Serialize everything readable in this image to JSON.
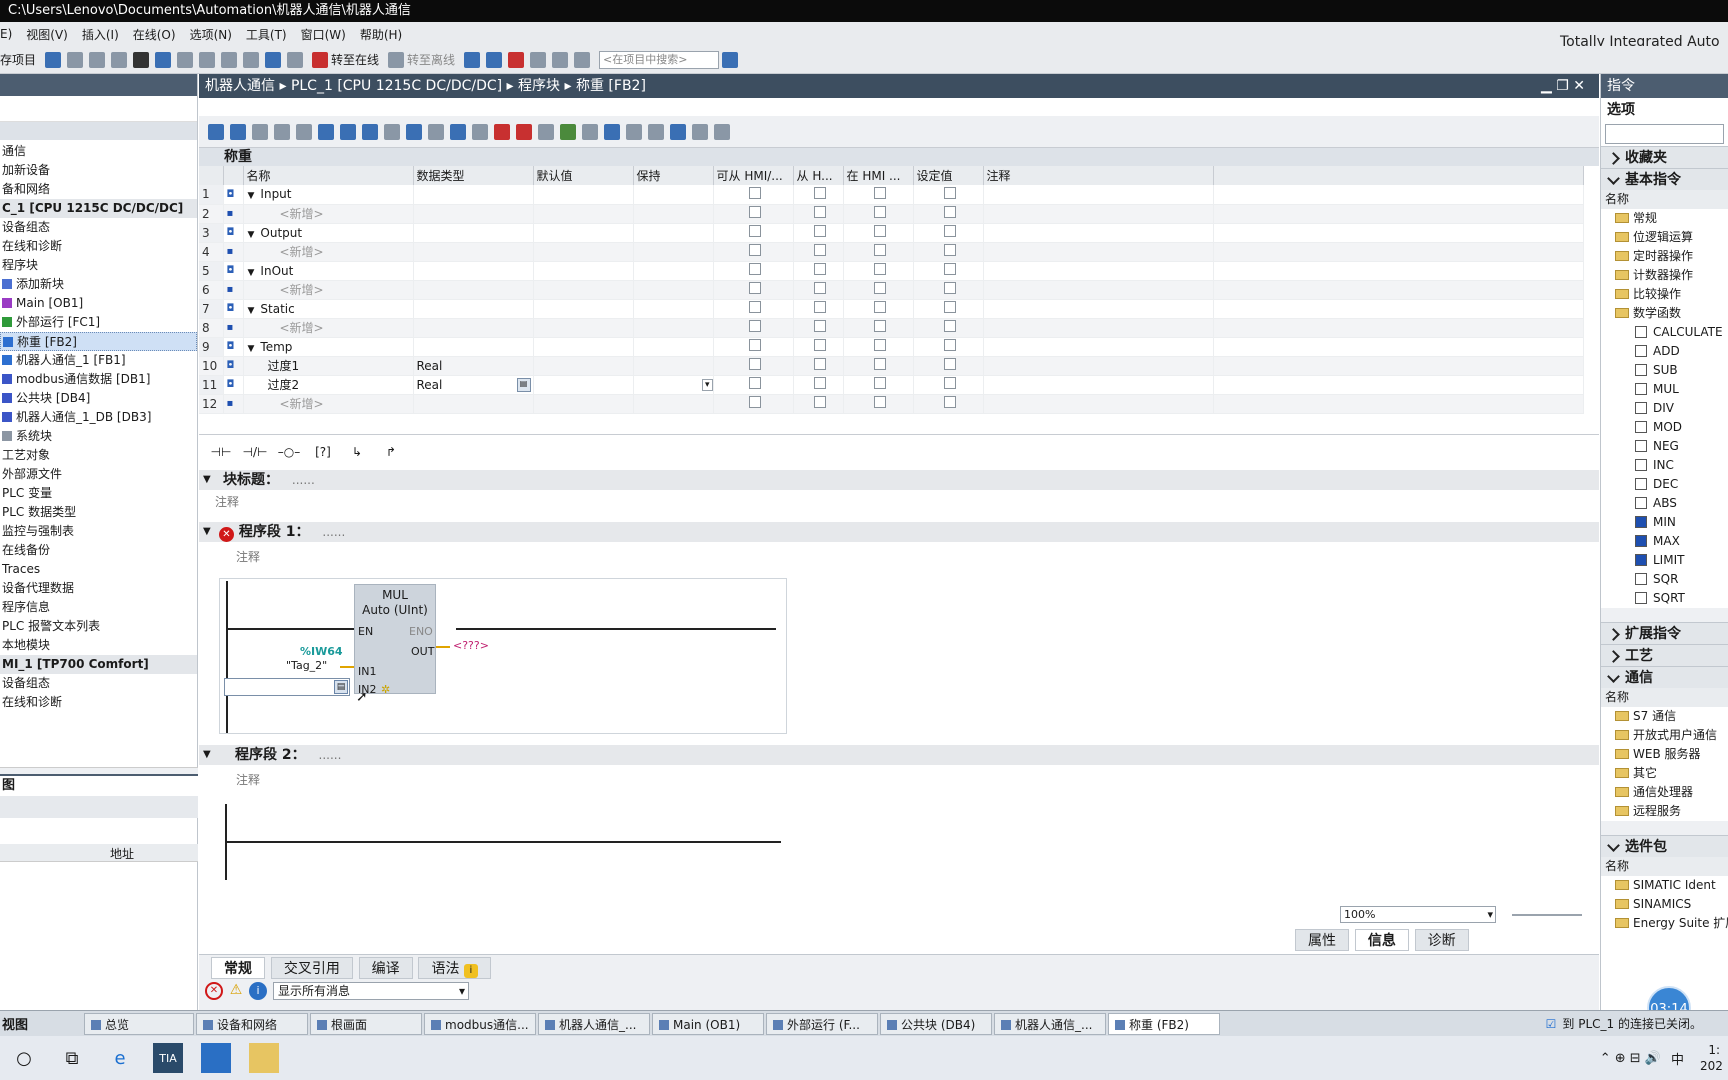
{
  "window": {
    "title": "C:\\Users\\Lenovo\\Documents\\Automation\\机器人通信\\机器人通信"
  },
  "menu": [
    "E)",
    "视图(V)",
    "插入(I)",
    "在线(O)",
    "选项(N)",
    "工具(T)",
    "窗口(W)",
    "帮助(H)"
  ],
  "brand": "Totally Integrated Auto",
  "toolbar": {
    "save_project": "存项目",
    "go_online": "转至在线",
    "go_offline": "转至离线",
    "search_placeholder": "<在项目中搜索>"
  },
  "left_tree": [
    "通信",
    "加新设备",
    "备和网络",
    "C_1 [CPU 1215C DC/DC/DC]",
    "设备组态",
    "在线和诊断",
    "程序块",
    "添加新块",
    "Main [OB1]",
    "外部运行 [FC1]",
    "称重 [FB2]",
    "机器人通信_1 [FB1]",
    "modbus通信数据 [DB1]",
    "公共块 [DB4]",
    "机器人通信_1_DB [DB3]",
    "系统块",
    "工艺对象",
    "外部源文件",
    "PLC 变量",
    "PLC 数据类型",
    "监控与强制表",
    "在线备份",
    "Traces",
    "设备代理数据",
    "程序信息",
    "PLC 报警文本列表",
    "本地模块",
    "MI_1 [TP700 Comfort]",
    "设备组态",
    "在线和诊断"
  ],
  "left_bottom": {
    "title": "图",
    "col": "地址"
  },
  "editor": {
    "breadcrumb": [
      "机器人通信",
      "PLC_1 [CPU 1215C DC/DC/DC]",
      "程序块",
      "称重 [FB2]"
    ],
    "block_title": "称重",
    "columns": [
      "名称",
      "数据类型",
      "默认值",
      "保持",
      "可从 HMI/...",
      "从 H...",
      "在 HMI ...",
      "设定值",
      "注释"
    ],
    "rows": [
      {
        "n": "1",
        "name": "Input",
        "type": ""
      },
      {
        "n": "2",
        "name": "<新增>",
        "type": ""
      },
      {
        "n": "3",
        "name": "Output",
        "type": ""
      },
      {
        "n": "4",
        "name": "<新增>",
        "type": ""
      },
      {
        "n": "5",
        "name": "InOut",
        "type": ""
      },
      {
        "n": "6",
        "name": "<新增>",
        "type": ""
      },
      {
        "n": "7",
        "name": "Static",
        "type": ""
      },
      {
        "n": "8",
        "name": "<新增>",
        "type": ""
      },
      {
        "n": "9",
        "name": "Temp",
        "type": ""
      },
      {
        "n": "10",
        "name": "过度1",
        "type": "Real"
      },
      {
        "n": "11",
        "name": "过度2",
        "type": "Real"
      },
      {
        "n": "12",
        "name": "<新增>",
        "type": ""
      }
    ]
  },
  "ladder": {
    "block_heading": "块标题：",
    "comment": "注释",
    "network1": "程序段 1：",
    "network2": "程序段 2：",
    "dots": "......",
    "mul": {
      "name": "MUL",
      "type": "Auto (UInt)",
      "en": "EN",
      "eno": "ENO",
      "out": "OUT",
      "out_val": "<???>",
      "in1": "IN1",
      "in2": "IN2",
      "tag_addr": "%IW64",
      "tag_name": "\"Tag_2\""
    }
  },
  "zoom": "100%",
  "inspector_tabs": [
    "属性",
    "信息",
    "诊断"
  ],
  "bottom_tabs": [
    "常规",
    "交叉引用",
    "编译",
    "语法"
  ],
  "message_filter": "显示所有消息",
  "right": {
    "title": "指令",
    "options": "选项",
    "favorites": "收藏夹",
    "basic": "基本指令",
    "name_col": "名称",
    "basic_items": [
      "常规",
      "位逻辑运算",
      "定时器操作",
      "计数器操作",
      "比较操作",
      "数学函数"
    ],
    "math_items": [
      "CALCULATE",
      "ADD",
      "SUB",
      "MUL",
      "DIV",
      "MOD",
      "NEG",
      "INC",
      "DEC",
      "ABS",
      "MIN",
      "MAX",
      "LIMIT",
      "SQR",
      "SQRT"
    ],
    "ext": "扩展指令",
    "tech": "工艺",
    "comm": "通信",
    "comm_items": [
      "S7 通信",
      "开放式用户通信",
      "WEB 服务器",
      "其它",
      "通信处理器",
      "远程服务"
    ],
    "opt_pkg": "选件包",
    "opt_items": [
      "SIMATIC Ident",
      "SINAMICS",
      "Energy Suite 扩展"
    ]
  },
  "status": {
    "view": "视图",
    "tabs": [
      "总览",
      "设备和网络",
      "根画面",
      "modbus通信...",
      "机器人通信_...",
      "Main (OB1)",
      "外部运行 (F...",
      "公共块 (DB4)",
      "机器人通信_...",
      "称重 (FB2)"
    ],
    "message": "到 PLC_1 的连接已关闭。",
    "timer": "03:14"
  },
  "taskbar": {
    "ime": "中",
    "time": "1:",
    "year": "202"
  }
}
